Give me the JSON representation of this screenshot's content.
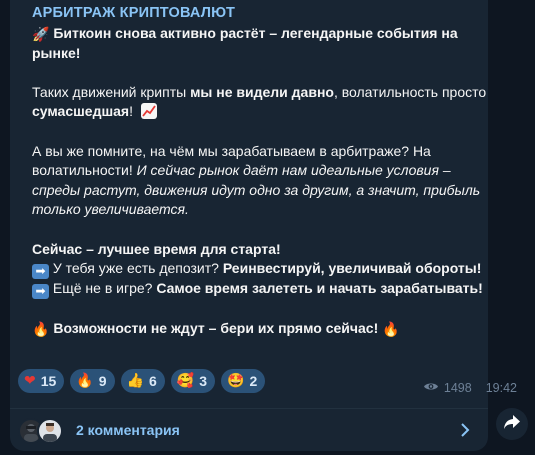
{
  "channel": {
    "name": "АРБИТРАЖ КРИПТОВАЛЮТ"
  },
  "post": {
    "line1_emoji": "🚀",
    "line1_text": "Биткоин снова активно растёт – легендарные события на рынке!",
    "p2_a": "Таких движений крипты ",
    "p2_b": "мы не видели давно",
    "p2_c": ", волатильность просто ",
    "p2_d": "сумасшедшая",
    "p2_e": "!",
    "p3_a": "А вы же помните, на чём мы зарабатываем в арбитраже? На волатильности! ",
    "p3_b": "И сейчас рынок даёт нам идеальные условия – спреды растут, движения идут одно за другим, а значит, прибыль только увеличивается.",
    "p4_title": "Сейчас – лучшее время для старта!",
    "p4_l1_a": "У тебя уже есть депозит? ",
    "p4_l1_b": "Реинвестируй, увеличивай обороты!",
    "p4_l2_a": "Ещё не в игре? ",
    "p4_l2_b": "Самое время залететь и начать зарабатывать!",
    "p5_emoji_left": "🔥",
    "p5_text": "Возможности не ждут – бери их прямо сейчас!",
    "p5_emoji_right": "🔥",
    "arrow_glyph": "➡"
  },
  "reactions": [
    {
      "emoji": "❤",
      "count": "15",
      "color": "#e53935"
    },
    {
      "emoji": "🔥",
      "count": "9",
      "color": "#ff7a1a"
    },
    {
      "emoji": "👍",
      "count": "6",
      "color": "#f5c242"
    },
    {
      "emoji": "🥰",
      "count": "3",
      "color": "#f5c242"
    },
    {
      "emoji": "🤩",
      "count": "2",
      "color": "#f5c242"
    }
  ],
  "meta": {
    "views": "1498",
    "time": "19:42"
  },
  "comments": {
    "label": "2 комментария"
  },
  "colors": {
    "background": "#0e1621",
    "bubble": "#182533",
    "accent": "#8ac4f5",
    "reaction_bg": "#2b5278"
  }
}
